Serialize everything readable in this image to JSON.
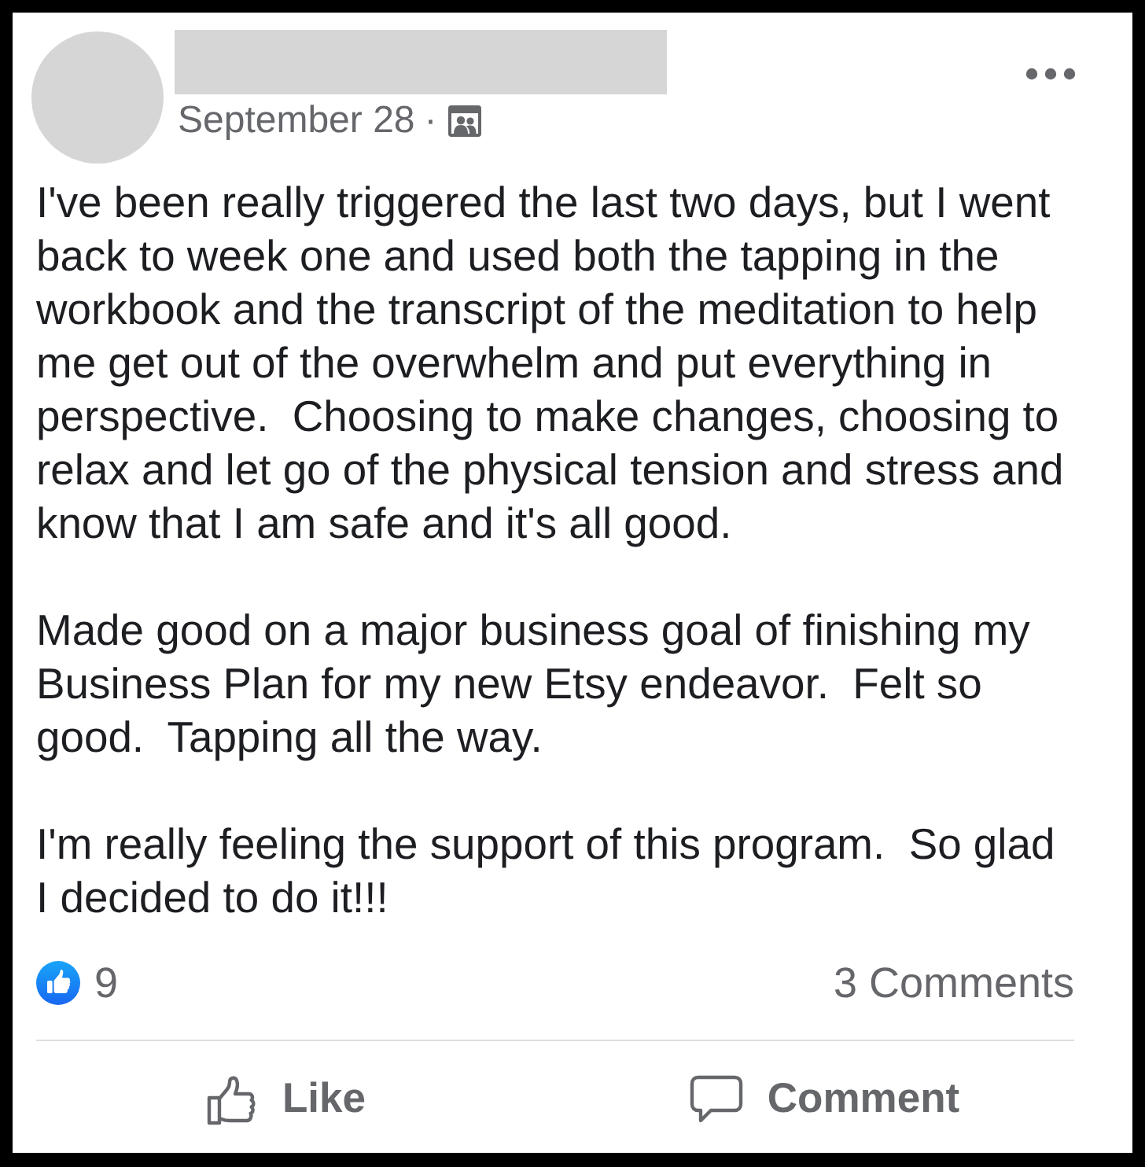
{
  "post": {
    "date": "September 28",
    "separator": "·",
    "paragraphs": [
      "I've been really triggered the last two days, but I went\nback to week one and used both the tapping in the\nworkbook and the transcript of the meditation to help\nme get out of the overwhelm and put everything in\nperspective.  Choosing to make changes, choosing to\nrelax and let go of the physical tension and stress and\nknow that I am safe and it's all good.",
      "Made good on a major business goal of finishing my\nBusiness Plan for my new Etsy endeavor.  Felt so\ngood.  Tapping all the way.",
      "I'm really feeling the support of this program.  So glad\nI decided to do it!!!"
    ]
  },
  "reactions": {
    "like_count": "9",
    "comments": "3 Comments"
  },
  "actions": [
    {
      "kind": "like",
      "label": "Like"
    },
    {
      "kind": "comment",
      "label": "Comment"
    }
  ]
}
